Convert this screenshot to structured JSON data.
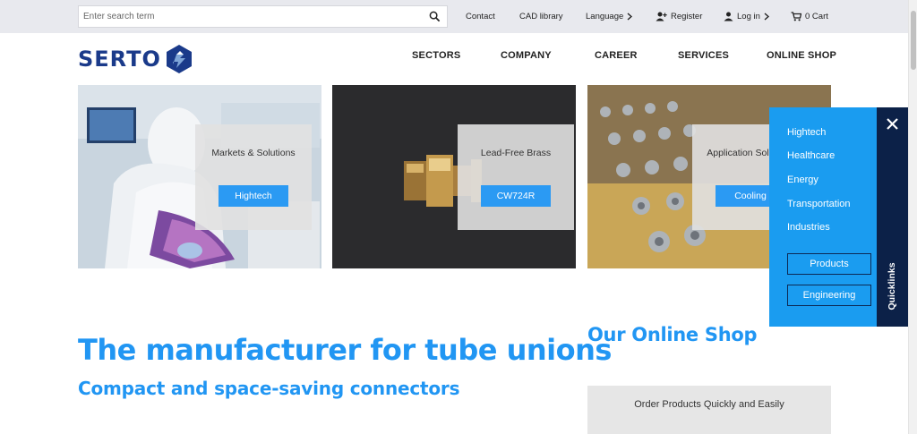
{
  "topbar": {
    "search_placeholder": "Enter search term",
    "contact": "Contact",
    "cad_library": "CAD library",
    "language": "Language",
    "register": "Register",
    "login": "Log in",
    "cart": "0 Cart"
  },
  "header": {
    "logo_text": "SERTO",
    "nav": [
      "SECTORS",
      "COMPANY",
      "CAREER",
      "SERVICES",
      "ONLINE SHOP"
    ]
  },
  "tiles": [
    {
      "title": "Markets & Solutions",
      "button": "Hightech"
    },
    {
      "title": "Lead-Free Brass",
      "button": "CW724R"
    },
    {
      "title": "Application Solutions",
      "button": "Cooling"
    }
  ],
  "quicklinks": {
    "label": "Quicklinks",
    "items": [
      "Hightech",
      "Healthcare",
      "Energy",
      "Transportation",
      "Industries"
    ],
    "buttons": [
      "Products",
      "Engineering"
    ]
  },
  "main": {
    "headline": "The manufacturer for tube unions",
    "subheadline": "Compact and space-saving connectors",
    "shop_title": "Our Online Shop",
    "shop_box_text": "Order Products Quickly and Easily"
  },
  "colors": {
    "accent": "#2196f3",
    "button_blue": "#2b9af3",
    "quicklinks_bg": "#1a9cf0",
    "navy": "#0c2148",
    "logo_blue": "#1a3a8a"
  }
}
